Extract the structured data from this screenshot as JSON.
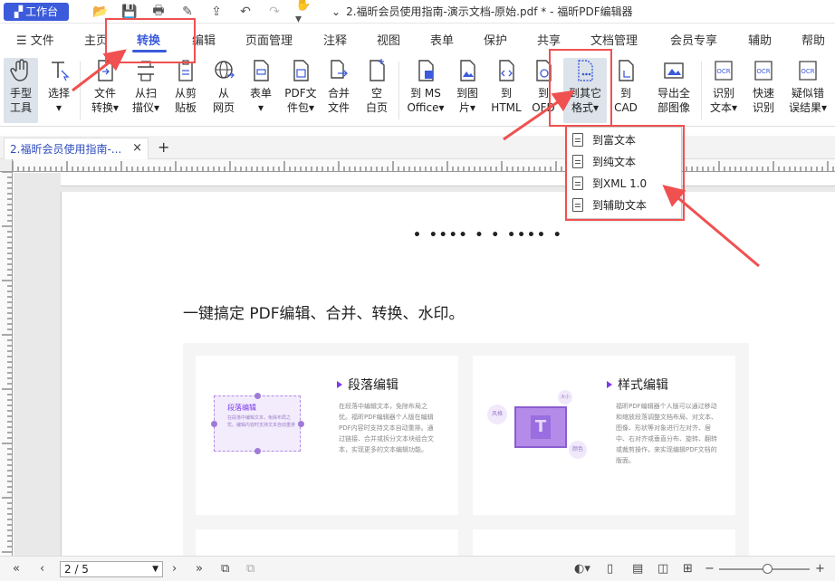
{
  "titlebar": {
    "workbench": "工作台",
    "doc_title": "2.福昕会员使用指南-演示文档-原始.pdf * - 福昕PDF编辑器"
  },
  "menu": {
    "file": "文件",
    "tabs": [
      "主页",
      "转换",
      "编辑",
      "页面管理",
      "注释",
      "视图",
      "表单",
      "保护",
      "共享",
      "文档管理",
      "会员专享",
      "辅助",
      "帮助"
    ],
    "active": "转换"
  },
  "ribbon": {
    "buttons": [
      {
        "l1": "手型",
        "l2": "工具"
      },
      {
        "l1": "选择",
        "l2": "▾"
      },
      {
        "l1": "文件",
        "l2": "转换▾"
      },
      {
        "l1": "从扫",
        "l2": "描仪▾"
      },
      {
        "l1": "从剪",
        "l2": "贴板"
      },
      {
        "l1": "从",
        "l2": "网页"
      },
      {
        "l1": "表单",
        "l2": "▾"
      },
      {
        "l1": "PDF文",
        "l2": "件包▾"
      },
      {
        "l1": "合并",
        "l2": "文件"
      },
      {
        "l1": "空",
        "l2": "白页"
      },
      {
        "l1": "到 MS",
        "l2": "Office▾"
      },
      {
        "l1": "到图",
        "l2": "片▾"
      },
      {
        "l1": "到",
        "l2": "HTML"
      },
      {
        "l1": "到",
        "l2": "OFD"
      },
      {
        "l1": "到其它",
        "l2": "格式▾"
      },
      {
        "l1": "到",
        "l2": "CAD"
      },
      {
        "l1": "导出全",
        "l2": "部图像"
      },
      {
        "l1": "识别",
        "l2": "文本▾"
      },
      {
        "l1": "快速",
        "l2": "识别"
      },
      {
        "l1": "疑似错",
        "l2": "误结果▾"
      }
    ]
  },
  "dropdown": {
    "items": [
      "到富文本",
      "到纯文本",
      "到XML 1.0",
      "到辅助文本"
    ]
  },
  "doc_tab": {
    "label": "2.福昕会员使用指南-...",
    "close": "×",
    "add": "+"
  },
  "page": {
    "dots": "• •••• • • •••• •",
    "headline": "一键搞定 PDF编辑、合并、转换、水印。",
    "cards": [
      {
        "title": "段落编辑",
        "text": "在段落中编辑文本，免除布局之忧。福昕PDF编辑器个人版在编辑PDF内容时支持文本自动重排。通过链接、合并或拆分文本块组合文本，实现更多的文本编辑功能。",
        "demo_title": "段落编辑",
        "demo_text": "在段落中编辑文本，免除布局之忧。编辑内容时支持文本自动重排"
      },
      {
        "title": "样式编辑",
        "text": "福昕PDF编辑器个人版可以通过移动和缩放段落调整文档布局、对文本、图像、形状等对象进行左对齐、居中、右对齐或垂直分布、旋转、翻转或裁剪操作，来实现编辑PDF文档的版面。",
        "tags": [
          "风格",
          "大小",
          "颜色"
        ],
        "glyph": "T"
      }
    ]
  },
  "status": {
    "page_value": "2 / 5"
  },
  "colors": {
    "accent": "#3b5bdb",
    "annotation": "#f05050",
    "purple": "#7c3aed"
  }
}
